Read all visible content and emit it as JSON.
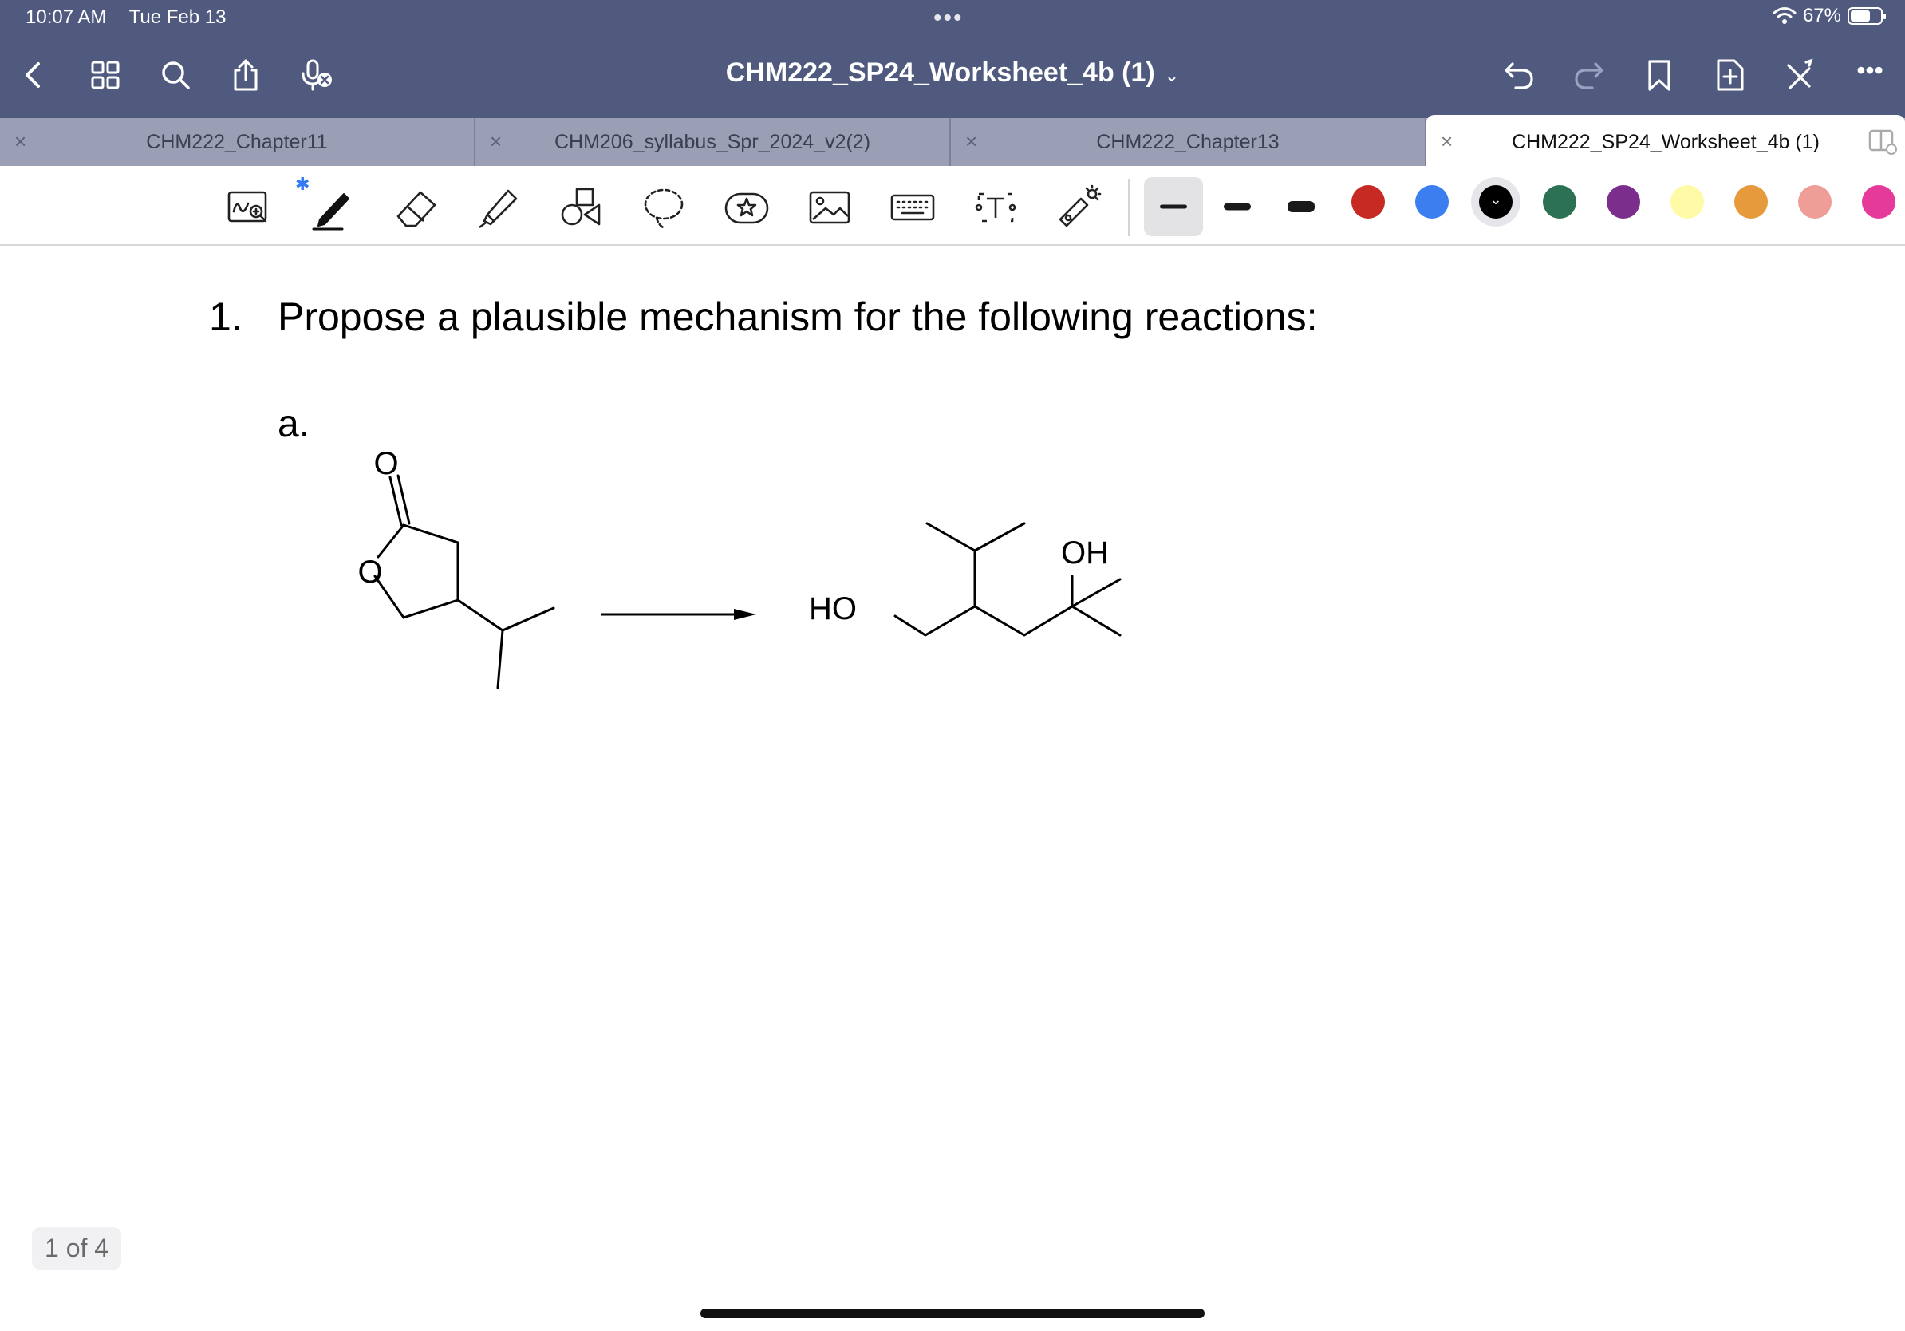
{
  "status_bar": {
    "time": "10:07 AM",
    "date": "Tue Feb 13",
    "multitask_dots": "•••",
    "battery_text": "67%",
    "battery_level": 0.67
  },
  "nav": {
    "title": "CHM222_SP24_Worksheet_4b (1)",
    "title_chevron": "⌄",
    "left_icons": [
      "back-chevron-icon",
      "grid-icon",
      "search-icon",
      "share-icon",
      "microphone-off-icon"
    ],
    "right_icons": [
      "undo-icon",
      "redo-icon",
      "bookmark-icon",
      "add-page-icon",
      "close-toolbar-icon",
      "more-icon"
    ],
    "more_label": "•••"
  },
  "tabs": [
    {
      "label": "CHM222_Chapter11",
      "close": "×",
      "active": false
    },
    {
      "label": "CHM206_syllabus_Spr_2024_v2(2)",
      "close": "×",
      "active": false
    },
    {
      "label": "CHM222_Chapter13",
      "close": "×",
      "active": false
    },
    {
      "label": "CHM222_SP24_Worksheet_4b (1)",
      "close": "×",
      "active": true
    }
  ],
  "toolbar": {
    "bluetooth_glyph": "✱",
    "tools": [
      "handwriting-search-icon",
      "pen-icon",
      "eraser-icon",
      "highlighter-icon",
      "shapes-icon",
      "lasso-icon",
      "sticker-icon",
      "image-icon",
      "keyboard-icon",
      "text-box-icon",
      "laser-pointer-icon"
    ],
    "thickness_selected": 0,
    "colors": [
      "#c62a22",
      "#3a7ef0",
      "#000000",
      "#2d7155",
      "#7c2e8c",
      "#fefaa6",
      "#e79a3c",
      "#ee9d97",
      "#e53a9a"
    ],
    "selected_color": "#000000",
    "selected_check": "⌄"
  },
  "document": {
    "question_number": "1.",
    "question_text": "Propose a plausible mechanism for the following reactions:",
    "part_label": "a.",
    "reactant_labels": {
      "carbonyl_o": "O",
      "ring_o": "O"
    },
    "product_labels": {
      "ho": "HO",
      "oh": "OH"
    }
  },
  "page_indicator": "1 of 4"
}
